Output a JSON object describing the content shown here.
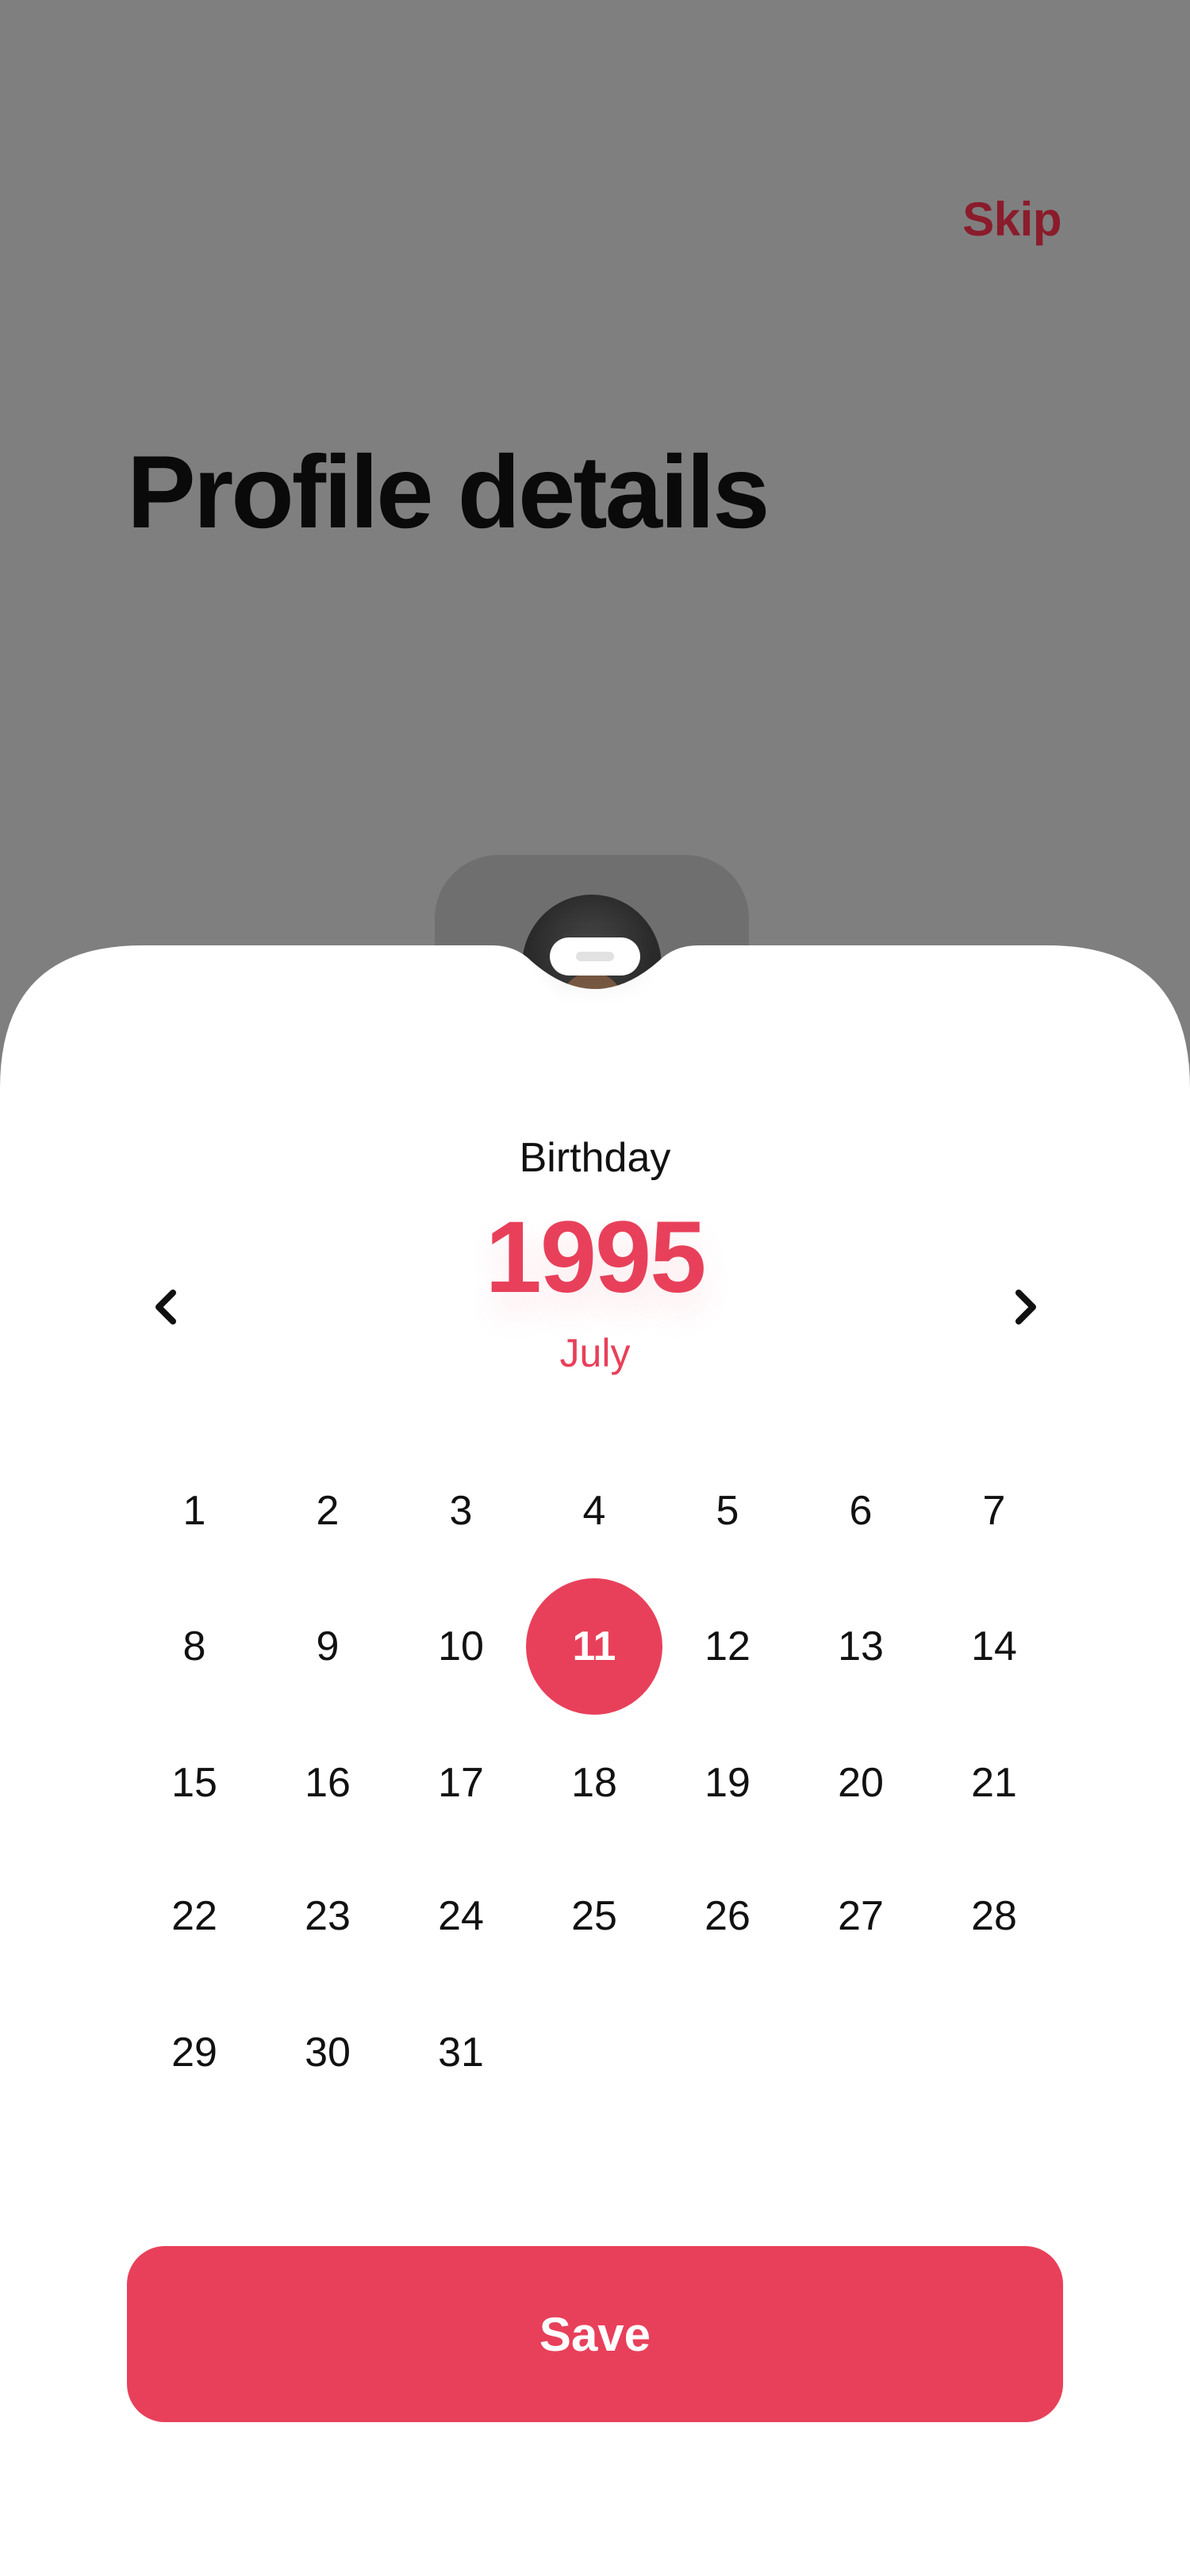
{
  "header": {
    "skip_label": "Skip",
    "title": "Profile details"
  },
  "picker": {
    "label": "Birthday",
    "year": "1995",
    "month": "July",
    "prev_icon": "chevron-left-icon",
    "next_icon": "chevron-right-icon",
    "selected_day": "11",
    "days": [
      "1",
      "2",
      "3",
      "4",
      "5",
      "6",
      "7",
      "8",
      "9",
      "10",
      "11",
      "12",
      "13",
      "14",
      "15",
      "16",
      "17",
      "18",
      "19",
      "20",
      "21",
      "22",
      "23",
      "24",
      "25",
      "26",
      "27",
      "28",
      "29",
      "30",
      "31"
    ]
  },
  "actions": {
    "save_label": "Save"
  },
  "colors": {
    "accent": "#e8405a",
    "skip": "#8a1c2b",
    "overlay": "#7f7f7f",
    "sheet": "#ffffff"
  }
}
